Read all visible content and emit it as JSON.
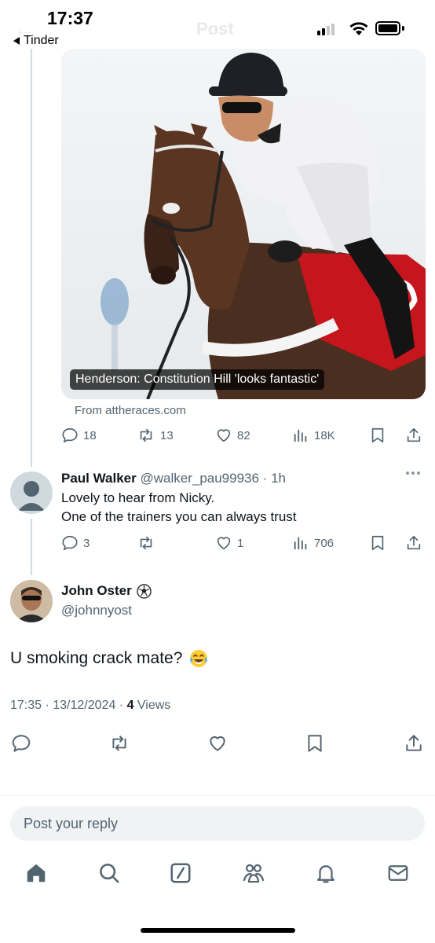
{
  "status_bar": {
    "time": "17:37",
    "back_label": "Tinder"
  },
  "header": {
    "title": "Post"
  },
  "link_card": {
    "caption": "Henderson: Constitution Hill 'looks fantastic'",
    "source": "From attheraces.com"
  },
  "tweet_stats": {
    "replies": "18",
    "reposts": "13",
    "likes": "82",
    "views": "18K"
  },
  "reply": {
    "name": "Paul Walker",
    "handle": "@walker_pau99936 · 1h",
    "line1": "Lovely to hear from Nicky.",
    "line2": "One of the trainers you can always trust",
    "stats": {
      "replies": "3",
      "reposts": "",
      "likes": "1",
      "views": "706"
    }
  },
  "main_tweet": {
    "name": "John Oster",
    "name_emoji": "soccer-ball-icon",
    "handle": "@johnnyost",
    "text": "U smoking crack mate?",
    "text_emoji": "laughing-tears-emoji",
    "timestamp": "17:35 · 13/12/2024 · ",
    "view_count": "4",
    "views_label": " Views"
  },
  "composer": {
    "placeholder": "Post your reply"
  },
  "tab_bar": [
    "home-icon",
    "search-icon",
    "grok-icon",
    "communities-icon",
    "notifications-icon",
    "messages-icon"
  ],
  "colors": {
    "text": "#0f1419",
    "secondary": "#536471",
    "divider": "#eff3f4",
    "thread": "#cfd9de"
  }
}
